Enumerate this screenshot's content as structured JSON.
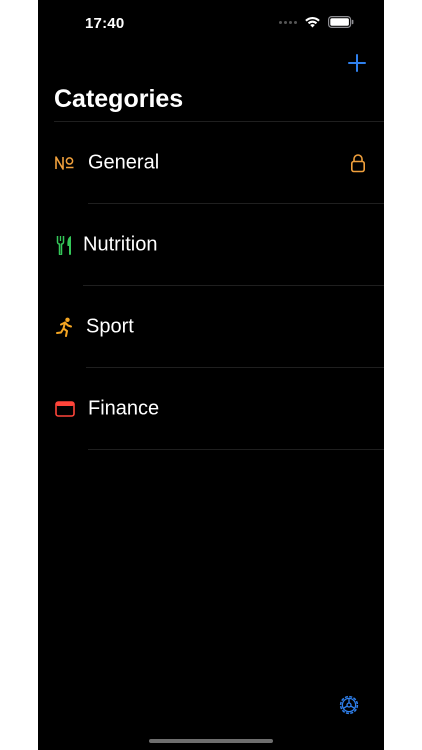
{
  "status": {
    "time": "17:40"
  },
  "nav": {
    "title": "Categories",
    "add_icon": "plus-icon"
  },
  "colors": {
    "accent": "#2f80ed",
    "general": "#f0a03c",
    "nutrition": "#34c759",
    "sport": "#f5a623",
    "finance": "#ff453a"
  },
  "categories": [
    {
      "label": "General",
      "icon": "number-sign-icon",
      "locked": true
    },
    {
      "label": "Nutrition",
      "icon": "fork-knife-icon",
      "locked": false
    },
    {
      "label": "Sport",
      "icon": "running-person-icon",
      "locked": false
    },
    {
      "label": "Finance",
      "icon": "window-icon",
      "locked": false
    }
  ],
  "toolbar": {
    "settings_icon": "gear-icon"
  }
}
